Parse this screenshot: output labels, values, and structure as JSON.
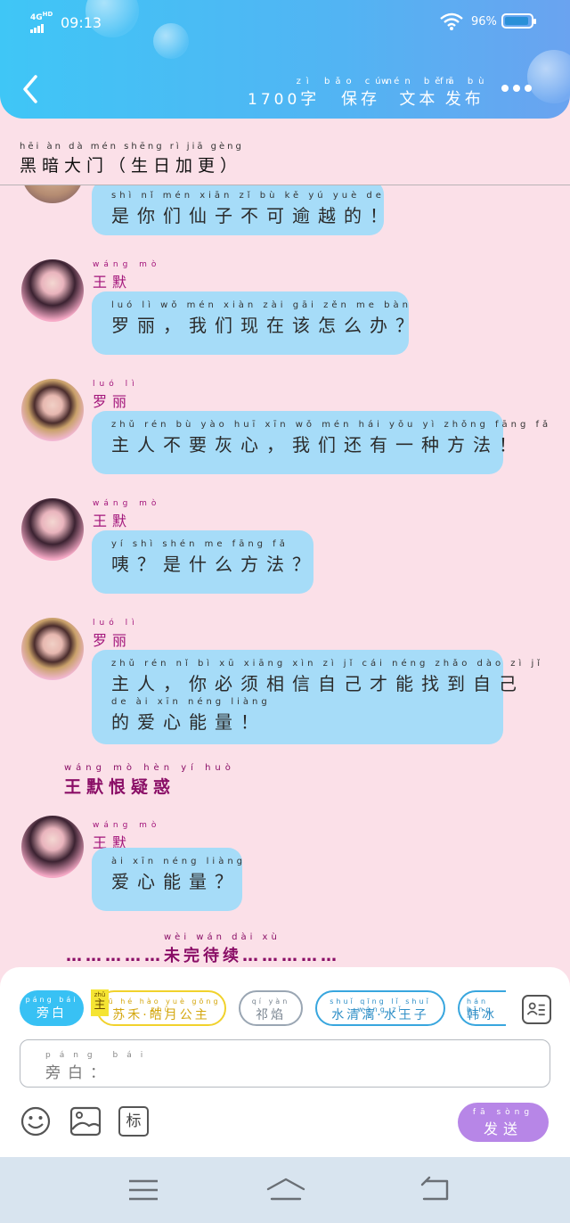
{
  "status_bar": {
    "network": "4G",
    "network_sup": "HD",
    "time": "09:13",
    "battery": "96%"
  },
  "header": {
    "word_count": {
      "number": "1700",
      "py": "zì",
      "hz": "字"
    },
    "save": {
      "py": "bǎo cún",
      "hz": "保存"
    },
    "text": {
      "py": "wén běn",
      "hz": "文本"
    },
    "publish": {
      "py": "fā bù",
      "hz": "发布"
    }
  },
  "chapter": {
    "py": "hēi àn dà mén   shēng rì jiā gèng",
    "hz": "黑暗大门（生日加更）"
  },
  "messages": [
    {
      "py": "shì  nǐ  mén xiān  zǐ   bù  kě  yú  yuè  de",
      "hz": "是你们仙子不可逾越的！"
    },
    {
      "name_py": "wáng mò",
      "name": "王默",
      "py": "luó  lì          wǒ  mén xiàn zài  gāi  zěn  me  bàn",
      "hz": "罗丽，我们现在该怎么办？"
    },
    {
      "name_py": "luó  lì",
      "name": "罗丽",
      "py": "zhǔ rén  bù  yào  huī  xīn       wǒ  mén  hái  yǒu  yì  zhǒng fāng fǎ",
      "hz": "主人不要灰心，我们还有一种方法！"
    },
    {
      "name_py": "wáng mò",
      "name": "王默",
      "py": "yí       shì shén  me  fāng  fǎ",
      "hz": "咦？是什么方法？"
    },
    {
      "name_py": "luó  lì",
      "name": "罗丽",
      "py": "zhǔ rén         nǐ  bì  xū xiāng xìn  zì   jǐ  cái néng zhǎo dào  zì   jǐ",
      "hz": "主人，你必须相信自己才能找到自己",
      "py2": "de   ài  xīn néng liàng",
      "hz2": "的爱心能量！"
    },
    {
      "name_py": "wáng mò",
      "name": "王默",
      "py": "ài  xīn néng liàng",
      "hz": "爱心能量？"
    }
  ],
  "narration": {
    "py": "wáng mò hèn  yí  huò",
    "hz": "王默恨疑惑"
  },
  "to_be_continued": {
    "py": "wèi  wán  dài  xù",
    "hz": "……………未完待续……………"
  },
  "roles": [
    {
      "py": "páng bái",
      "hz": "旁白"
    },
    {
      "tag": "主",
      "py": "sū  hé  hào yuè gōng zhǔ",
      "hz": "苏禾·皓月公主"
    },
    {
      "py": "qí  yàn",
      "hz": "祁焰"
    },
    {
      "py": "shuǐ qīng  lǐ   shuǐ wáng zǐ",
      "hz": "水清漓·水王子"
    },
    {
      "py": "hán bīng",
      "hz": "韩冰"
    }
  ],
  "input": {
    "py": "páng bái",
    "hz": "旁白："
  },
  "toolbar": {
    "mark_label": "标"
  },
  "send": {
    "py": "fā sòng",
    "hz": "发送"
  }
}
